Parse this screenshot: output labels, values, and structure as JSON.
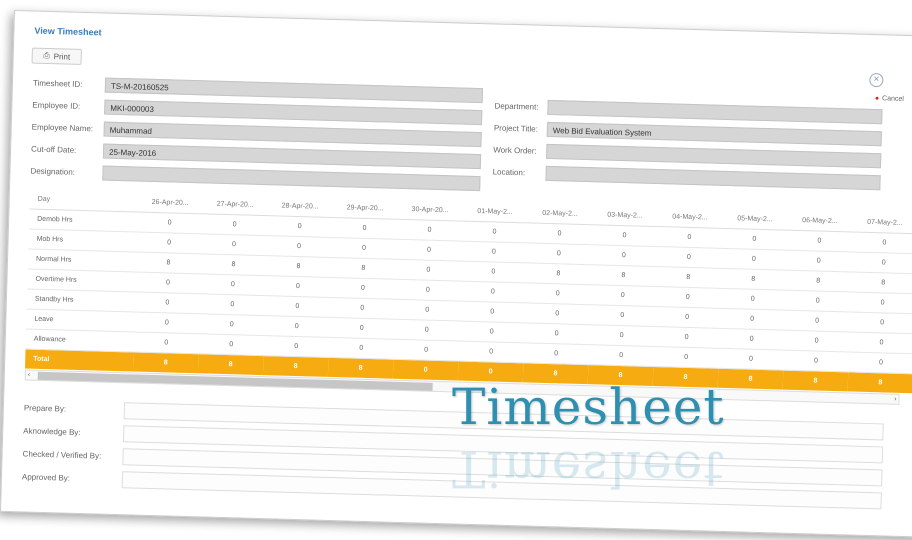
{
  "window": {
    "title": "View Timesheet"
  },
  "toolbar": {
    "print_label": "Print",
    "cancel_label": "Cancel"
  },
  "fields_left": [
    {
      "label": "Timesheet ID:",
      "value": "TS-M-20160525"
    },
    {
      "label": "Employee ID:",
      "value": "MKI-000003"
    },
    {
      "label": "Employee Name:",
      "value": "Muhammad"
    },
    {
      "label": "Cut-off Date:",
      "value": "25-May-2016"
    },
    {
      "label": "Designation:",
      "value": ""
    }
  ],
  "fields_right": [
    {
      "label": "Department:",
      "value": ""
    },
    {
      "label": "Project Title:",
      "value": "Web Bid Evaluation System"
    },
    {
      "label": "Work Order:",
      "value": ""
    },
    {
      "label": "Location:",
      "value": ""
    }
  ],
  "grid": {
    "header": [
      "Day",
      "26-Apr-20...",
      "27-Apr-20...",
      "28-Apr-20...",
      "29-Apr-20...",
      "30-Apr-20...",
      "01-May-2...",
      "02-May-2...",
      "03-May-2...",
      "04-May-2...",
      "05-May-2...",
      "06-May-2...",
      "07-May-2..."
    ],
    "rows": [
      {
        "label": "Demob Hrs",
        "values": [
          "0",
          "0",
          "0",
          "0",
          "0",
          "0",
          "0",
          "0",
          "0",
          "0",
          "0",
          "0"
        ]
      },
      {
        "label": "Mob Hrs",
        "values": [
          "0",
          "0",
          "0",
          "0",
          "0",
          "0",
          "0",
          "0",
          "0",
          "0",
          "0",
          "0"
        ]
      },
      {
        "label": "Normal Hrs",
        "values": [
          "8",
          "8",
          "8",
          "8",
          "0",
          "0",
          "8",
          "8",
          "8",
          "8",
          "8",
          "8"
        ]
      },
      {
        "label": "Overtime Hrs",
        "values": [
          "0",
          "0",
          "0",
          "0",
          "0",
          "0",
          "0",
          "0",
          "0",
          "0",
          "0",
          "0"
        ]
      },
      {
        "label": "Standby Hrs",
        "values": [
          "0",
          "0",
          "0",
          "0",
          "0",
          "0",
          "0",
          "0",
          "0",
          "0",
          "0",
          "0"
        ]
      },
      {
        "label": "Leave",
        "values": [
          "0",
          "0",
          "0",
          "0",
          "0",
          "0",
          "0",
          "0",
          "0",
          "0",
          "0",
          "0"
        ]
      },
      {
        "label": "Allowance",
        "values": [
          "0",
          "0",
          "0",
          "0",
          "0",
          "0",
          "0",
          "0",
          "0",
          "0",
          "0",
          "0"
        ]
      }
    ],
    "total": {
      "label": "Total",
      "values": [
        "8",
        "8",
        "8",
        "8",
        "0",
        "0",
        "8",
        "8",
        "8",
        "8",
        "8",
        "8"
      ]
    }
  },
  "scrollbar": {
    "left_arrow": "‹",
    "right_arrow": "›"
  },
  "signatures": [
    {
      "label": "Prepare By:"
    },
    {
      "label": "Aknowledge By:"
    },
    {
      "label": "Checked / Verified By:"
    },
    {
      "label": "Approved By:"
    }
  ],
  "overlay_text": "Timesheet",
  "colors": {
    "accent": "#3a7ab8",
    "total_row": "#f6ac10",
    "field_bg": "#d6d6d6",
    "overlay": "#2e8fb1",
    "cancel_icon": "#d9241b"
  }
}
